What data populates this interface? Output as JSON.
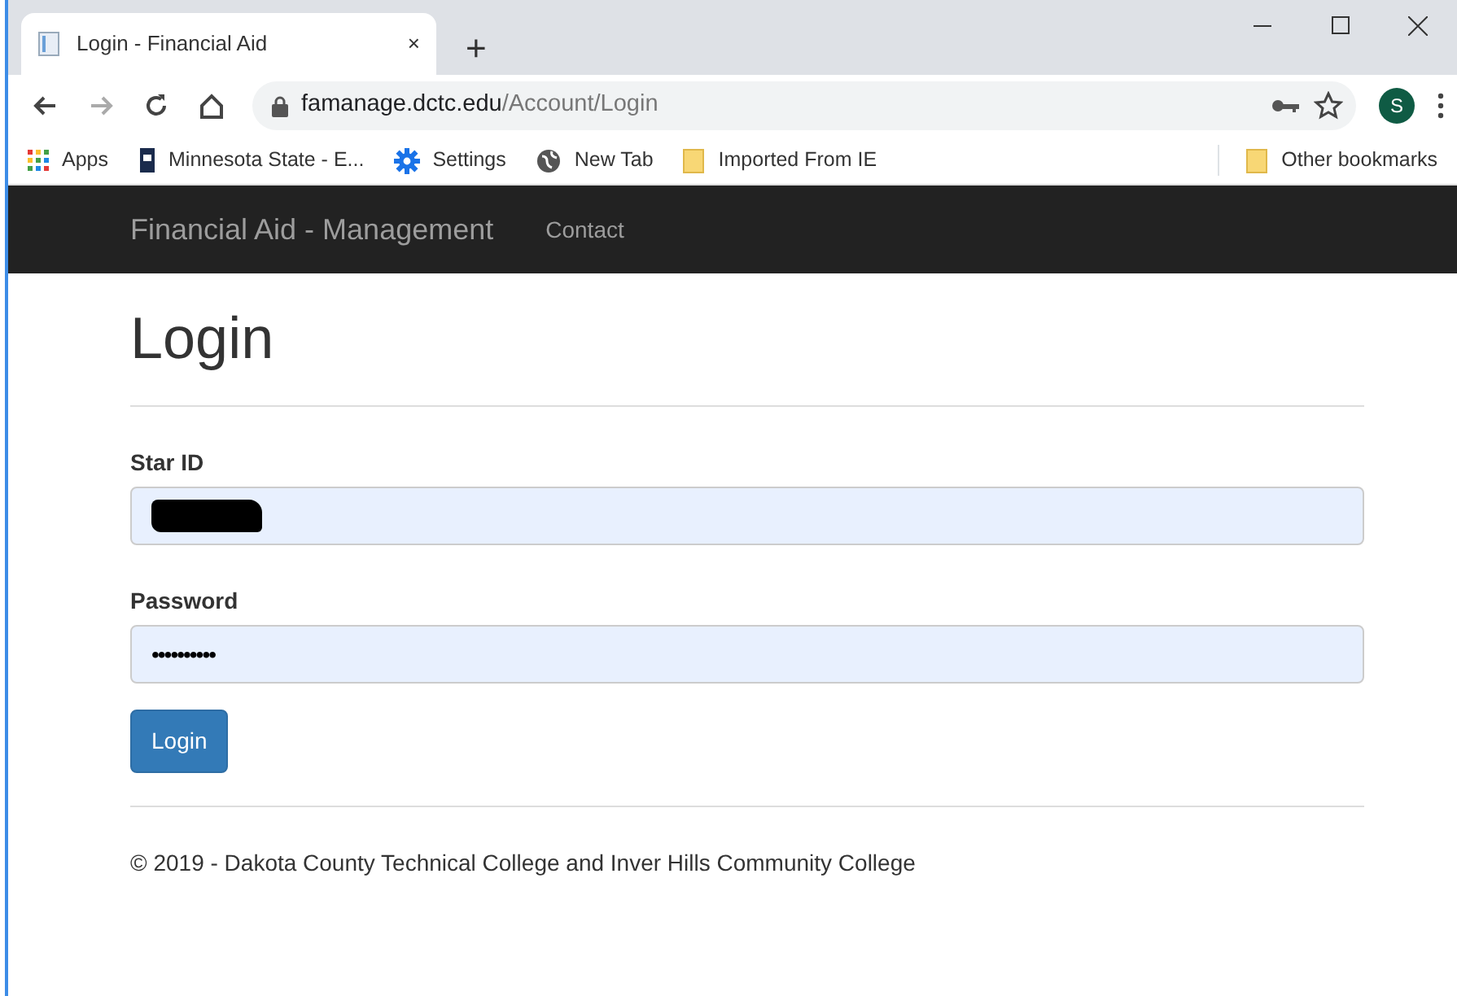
{
  "browser": {
    "tab": {
      "title": "Login - Financial Aid",
      "close": "×"
    },
    "new_tab": "+",
    "url_host": "famanage.dctc.edu",
    "url_path": "/Account/Login",
    "profile": "S",
    "bookmarks": [
      {
        "kind": "apps",
        "label": "Apps"
      },
      {
        "kind": "site",
        "label": "Minnesota State - E..."
      },
      {
        "kind": "gear",
        "label": "Settings"
      },
      {
        "kind": "globe",
        "label": "New Tab"
      },
      {
        "kind": "folder",
        "label": "Imported From IE"
      }
    ],
    "other_bookmarks": "Other bookmarks"
  },
  "navbar": {
    "brand": "Financial Aid - Management",
    "links": [
      "Contact"
    ]
  },
  "page": {
    "heading": "Login",
    "fields": [
      {
        "label": "Star ID",
        "kind": "redacted"
      },
      {
        "label": "Password",
        "kind": "password",
        "value": "••••••••••"
      }
    ],
    "button": "Login",
    "footer": "© 2019 - Dakota County Technical College and Inver Hills Community College"
  }
}
